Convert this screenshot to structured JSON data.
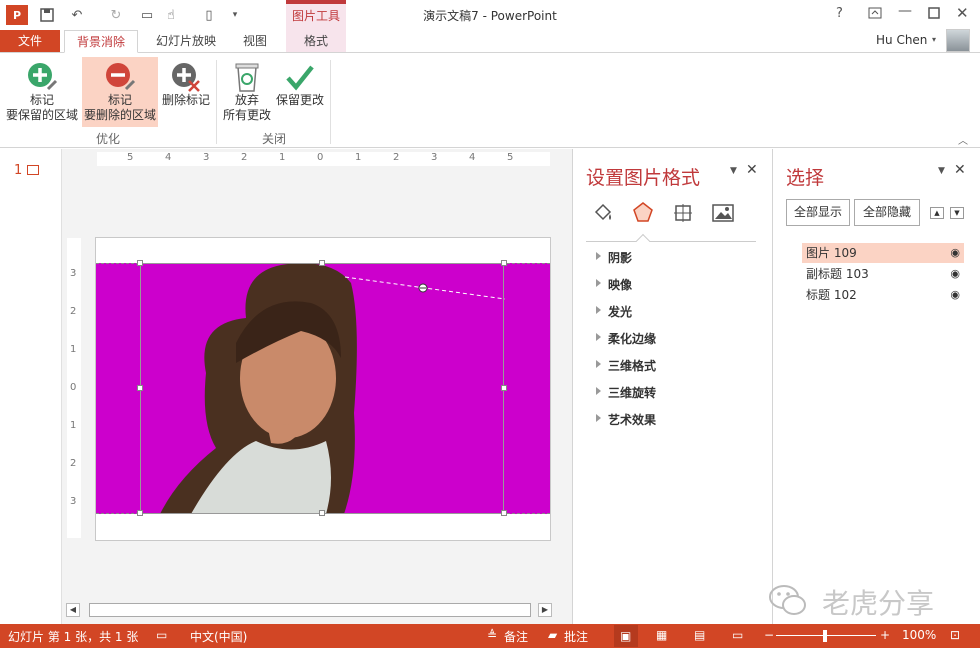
{
  "window": {
    "title": "演示文稿7 - PowerPoint",
    "user": "Hu Chen",
    "help": "?"
  },
  "quick_access": [
    "ppt-logo-icon",
    "save-icon",
    "undo-icon",
    "redo-icon",
    "start-from-beginning-icon",
    "touch-mode-icon",
    "new-icon",
    "customize-icon"
  ],
  "context_group": {
    "label": "图片工具"
  },
  "tabs": {
    "file": "文件",
    "items": [
      "背景消除",
      "幻灯片放映",
      "视图",
      "格式"
    ],
    "active": "背景消除"
  },
  "ribbon": {
    "buttons": [
      {
        "line1": "标记",
        "line2": "要保留的区域",
        "icon": "mark-keep-icon"
      },
      {
        "line1": "标记",
        "line2": "要删除的区域",
        "icon": "mark-remove-icon",
        "selected": true
      },
      {
        "line1": "删除标记",
        "line2": "",
        "icon": "delete-mark-icon"
      },
      {
        "line1": "放弃",
        "line2": "所有更改",
        "icon": "discard-icon"
      },
      {
        "line1": "保留更改",
        "line2": "",
        "icon": "keep-changes-icon"
      }
    ],
    "groups": [
      "优化",
      "关闭"
    ]
  },
  "slide_thumb": {
    "number": "1"
  },
  "rulers": {
    "h": [
      "5",
      "4",
      "3",
      "2",
      "1",
      "0",
      "1",
      "2",
      "3",
      "4",
      "5"
    ],
    "v": [
      "3",
      "2",
      "1",
      "0",
      "1",
      "2",
      "3"
    ]
  },
  "format_pane": {
    "title": "设置图片格式",
    "sections": [
      "阴影",
      "映像",
      "发光",
      "柔化边缘",
      "三维格式",
      "三维旋转",
      "艺术效果"
    ]
  },
  "selection_pane": {
    "title": "选择",
    "show_all": "全部显示",
    "hide_all": "全部隐藏",
    "items": [
      "图片 109",
      "副标题 103",
      "标题 102"
    ],
    "selected": "图片 109"
  },
  "status": {
    "slide": "幻灯片 第 1 张，共 1 张",
    "language": "中文(中国)",
    "notes": "备注",
    "comments": "批注",
    "zoom": "100%"
  },
  "watermark": "老虎分享",
  "colors": {
    "accent": "#d24625",
    "removal": "#cc00cc",
    "selected": "#fbd3c4"
  }
}
